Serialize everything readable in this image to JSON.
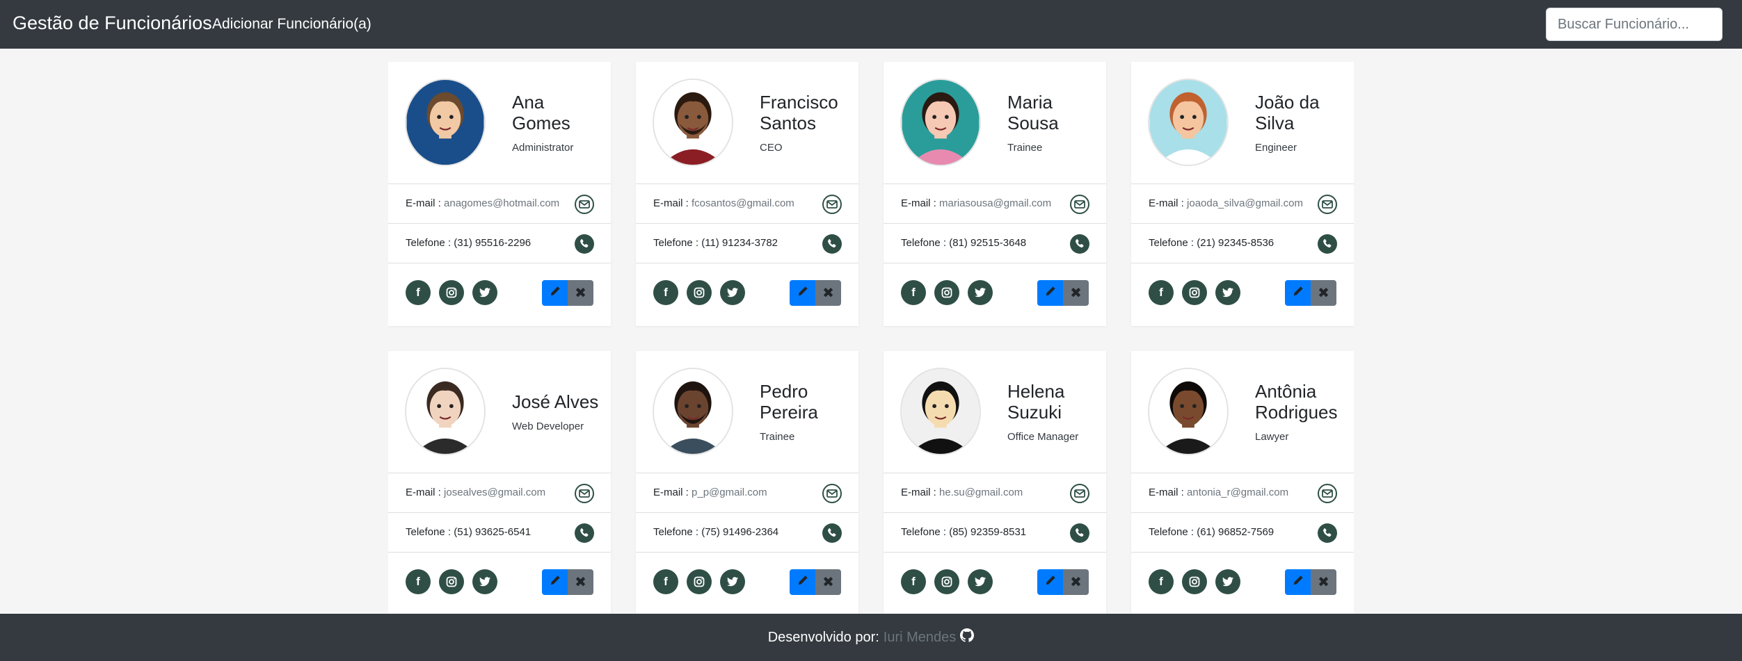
{
  "navbar": {
    "brand": "Gestão de Funcionários",
    "add_link": "Adicionar Funcionário(a)",
    "search_placeholder": "Buscar Funcionário..."
  },
  "employees": [
    {
      "first": "Ana",
      "last": "Gomes",
      "role": "Administrator",
      "email_label": "E-mail :",
      "email": "anagomes@hotmail.com",
      "phone_label": "Telefone :",
      "phone": "(31) 95516-2296"
    },
    {
      "first": "Francisco",
      "last": "Santos",
      "role": "CEO",
      "email_label": "E-mail :",
      "email": "fcosantos@gmail.com",
      "phone_label": "Telefone :",
      "phone": "(11) 91234-3782"
    },
    {
      "first": "Maria",
      "last": "Sousa",
      "role": "Trainee",
      "email_label": "E-mail :",
      "email": "mariasousa@gmail.com",
      "phone_label": "Telefone :",
      "phone": "(81) 92515-3648"
    },
    {
      "first": "João da",
      "last": "Silva",
      "role": "Engineer",
      "email_label": "E-mail :",
      "email": "joaoda_silva@gmail.com",
      "phone_label": "Telefone :",
      "phone": "(21) 92345-8536"
    },
    {
      "first": "José Alves",
      "last": "",
      "role": "Web Developer",
      "email_label": "E-mail :",
      "email": "josealves@gmail.com",
      "phone_label": "Telefone :",
      "phone": "(51) 93625-6541"
    },
    {
      "first": "Pedro",
      "last": "Pereira",
      "role": "Trainee",
      "email_label": "E-mail :",
      "email": "p_p@gmail.com",
      "phone_label": "Telefone :",
      "phone": "(75) 91496-2364"
    },
    {
      "first": "Helena",
      "last": "Suzuki",
      "role": "Office Manager",
      "email_label": "E-mail :",
      "email": "he.su@gmail.com",
      "phone_label": "Telefone :",
      "phone": "(85) 92359-8531"
    },
    {
      "first": "Antônia",
      "last": "Rodrigues",
      "role": "Lawyer",
      "email_label": "E-mail :",
      "email": "antonia_r@gmail.com",
      "phone_label": "Telefone :",
      "phone": "(61) 96852-7569"
    }
  ],
  "icons": {
    "email": "envelope-icon",
    "phone": "phone-icon",
    "facebook": "facebook-icon",
    "instagram": "instagram-icon",
    "twitter": "twitter-icon",
    "edit": "pencil-icon",
    "delete": "close-icon"
  },
  "colors": {
    "navbar_bg": "#343a40",
    "icon_bg": "#2f4f46",
    "edit_button": "#007bff",
    "delete_button": "#6c757d",
    "page_bg": "#f5f5f5"
  },
  "footer": {
    "text": "Desenvolvido por:",
    "author": "Iuri Mendes"
  }
}
